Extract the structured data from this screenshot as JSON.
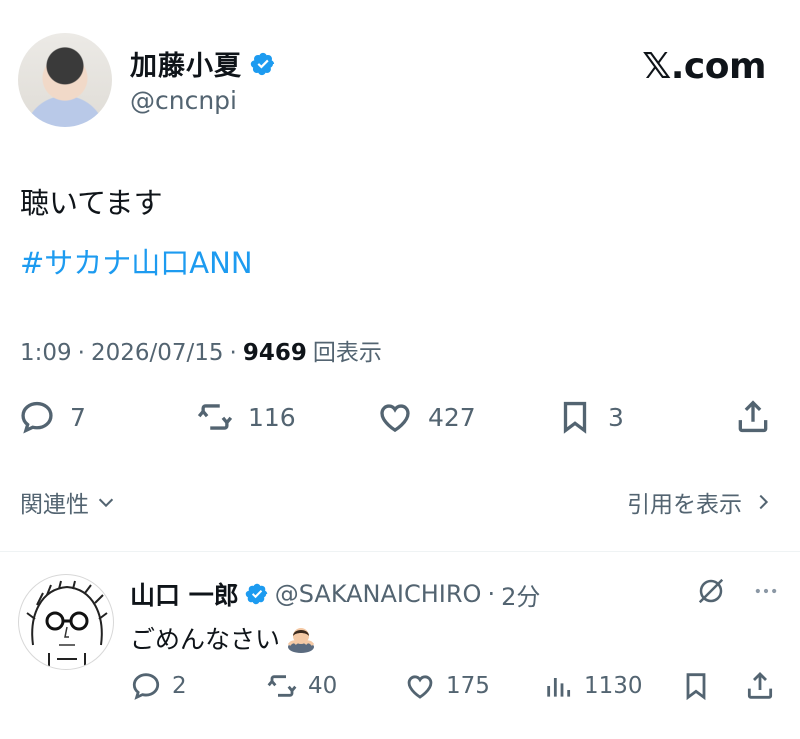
{
  "post": {
    "display_name": "加藤小夏",
    "handle": "@cncnpi",
    "site_logo": "𝕏.com",
    "text": "聴いてます",
    "hashtag": "#サカナ山口ANN",
    "time": "1:09",
    "sep1": "·",
    "date": "2026/07/15",
    "sep2": "·",
    "views_count": "9469",
    "views_label": "回表示",
    "actions": {
      "replies": "7",
      "reposts": "116",
      "likes": "427",
      "bookmarks": "3"
    },
    "related_label": "関連性",
    "quotes_label": "引用を表示"
  },
  "reply": {
    "display_name": "山口 一郎",
    "handle": "@SAKANAICHIRO",
    "sep": "·",
    "time_ago": "2分",
    "text": "ごめんなさい",
    "emoji": "bowing-person",
    "actions": {
      "replies": "2",
      "reposts": "40",
      "likes": "175",
      "views": "1130"
    }
  },
  "colors": {
    "accent": "#1d9bf0",
    "muted": "#536471",
    "text": "#0f1419"
  }
}
